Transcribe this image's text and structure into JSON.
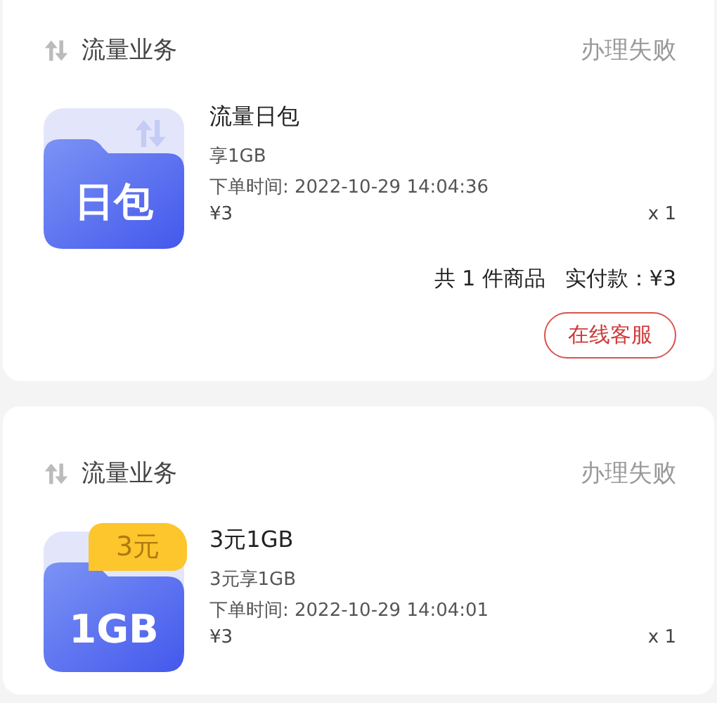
{
  "orders": [
    {
      "category": "流量业务",
      "status": "办理失败",
      "product": {
        "thumb": {
          "kind": "arrows",
          "label": "日包"
        },
        "title": "流量日包",
        "subtitle": "享1GB",
        "time": "下单时间: 2022-10-29 14:04:36",
        "price": "¥3",
        "qty": "x 1"
      },
      "summary": {
        "count": "共 1 件商品",
        "paid": "实付款：¥3"
      },
      "action": "在线客服"
    },
    {
      "category": "流量业务",
      "status": "办理失败",
      "product": {
        "thumb": {
          "kind": "badge",
          "label": "1GB",
          "badge": "3元"
        },
        "title": "3元1GB",
        "subtitle": "3元享1GB",
        "time": "下单时间: 2022-10-29 14:04:01",
        "price": "¥3",
        "qty": "x 1"
      }
    }
  ]
}
